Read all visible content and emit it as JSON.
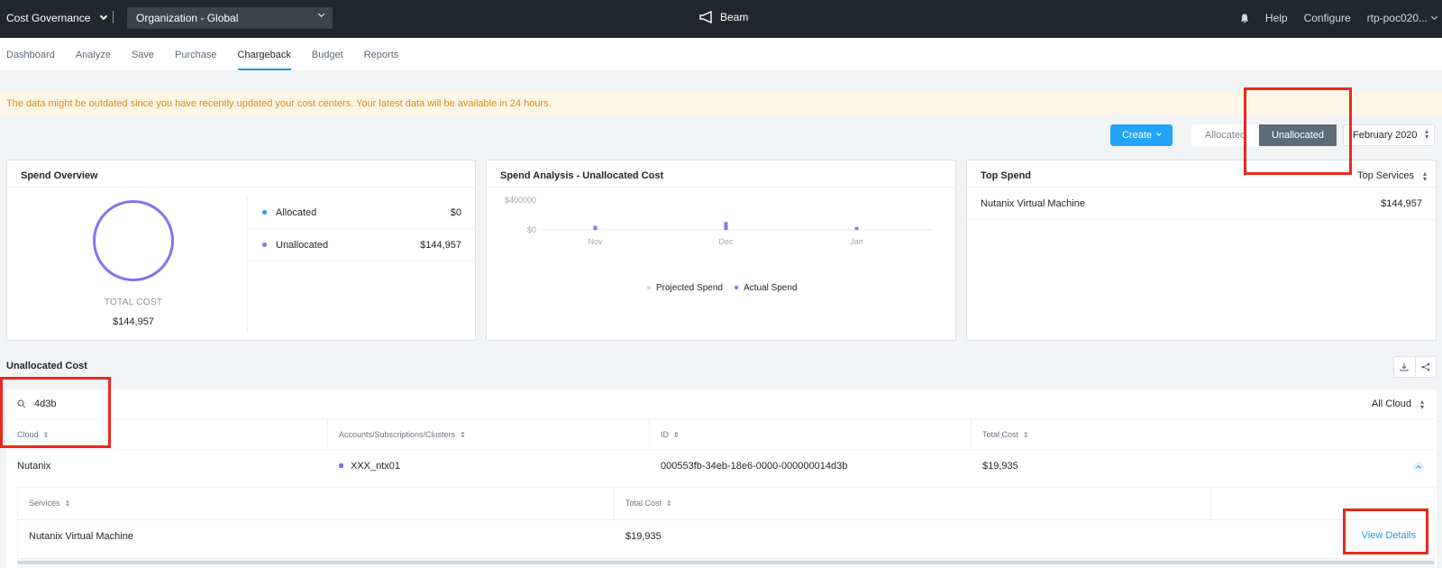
{
  "topbar": {
    "app_name": "Cost Governance",
    "org_select": "Organization - Global",
    "brand": "Beam",
    "help": "Help",
    "configure": "Configure",
    "user": "rtp-poc020..."
  },
  "tabs": [
    "Dashboard",
    "Analyze",
    "Save",
    "Purchase",
    "Chargeback",
    "Budget",
    "Reports"
  ],
  "active_tab": "Chargeback",
  "banner": "The data might be outdated since you have recently updated your cost centers. Your latest data will be available in 24 hours.",
  "toolbar": {
    "create": "Create",
    "allocated": "Allocated",
    "unallocated": "Unallocated",
    "period": "February 2020"
  },
  "spend_overview": {
    "title": "Spend Overview",
    "total_label": "TOTAL COST",
    "total_value": "$144,957",
    "items": [
      {
        "label": "Allocated",
        "value": "$0",
        "color": "#1b9ae4"
      },
      {
        "label": "Unallocated",
        "value": "$144,957",
        "color": "#8c6ff0"
      }
    ]
  },
  "spend_analysis": {
    "title": "Spend Analysis - Unallocated Cost",
    "legend_projected": "Projected Spend",
    "legend_actual": "Actual Spend"
  },
  "chart_data": {
    "type": "bar",
    "title": "Spend Analysis - Unallocated Cost",
    "categories": [
      "Nov",
      "Dec",
      "Jan"
    ],
    "y_ticks": [
      "$400000",
      "$0"
    ],
    "ylim": [
      0,
      400000
    ],
    "series": [
      {
        "name": "Actual Spend",
        "values": [
          55000,
          105000,
          40000
        ],
        "color": "#8c6ff0"
      }
    ],
    "legend": [
      "Projected Spend",
      "Actual Spend"
    ],
    "legend_placement": "bottom"
  },
  "top_spend": {
    "title": "Top Spend",
    "filter": "Top Services",
    "rows": [
      {
        "label": "Nutanix Virtual Machine",
        "value": "$144,957"
      }
    ]
  },
  "unallocated": {
    "title": "Unallocated Cost",
    "search_value": "4d3b",
    "cloud_filter": "All Cloud",
    "columns": [
      "Cloud",
      "Accounts/Subscriptions/Clusters",
      "ID",
      "Total Cost"
    ],
    "row": {
      "cloud": "Nutanix",
      "account": "XXX_ntx01",
      "id": "000553fb-34eb-18e6-0000-000000014d3b",
      "total": "$19,935"
    },
    "sub_columns": [
      "Services",
      "Total Cost"
    ],
    "sub_row": {
      "service": "Nutanix Virtual Machine",
      "total": "$19,935"
    },
    "view_details": "View Details"
  }
}
